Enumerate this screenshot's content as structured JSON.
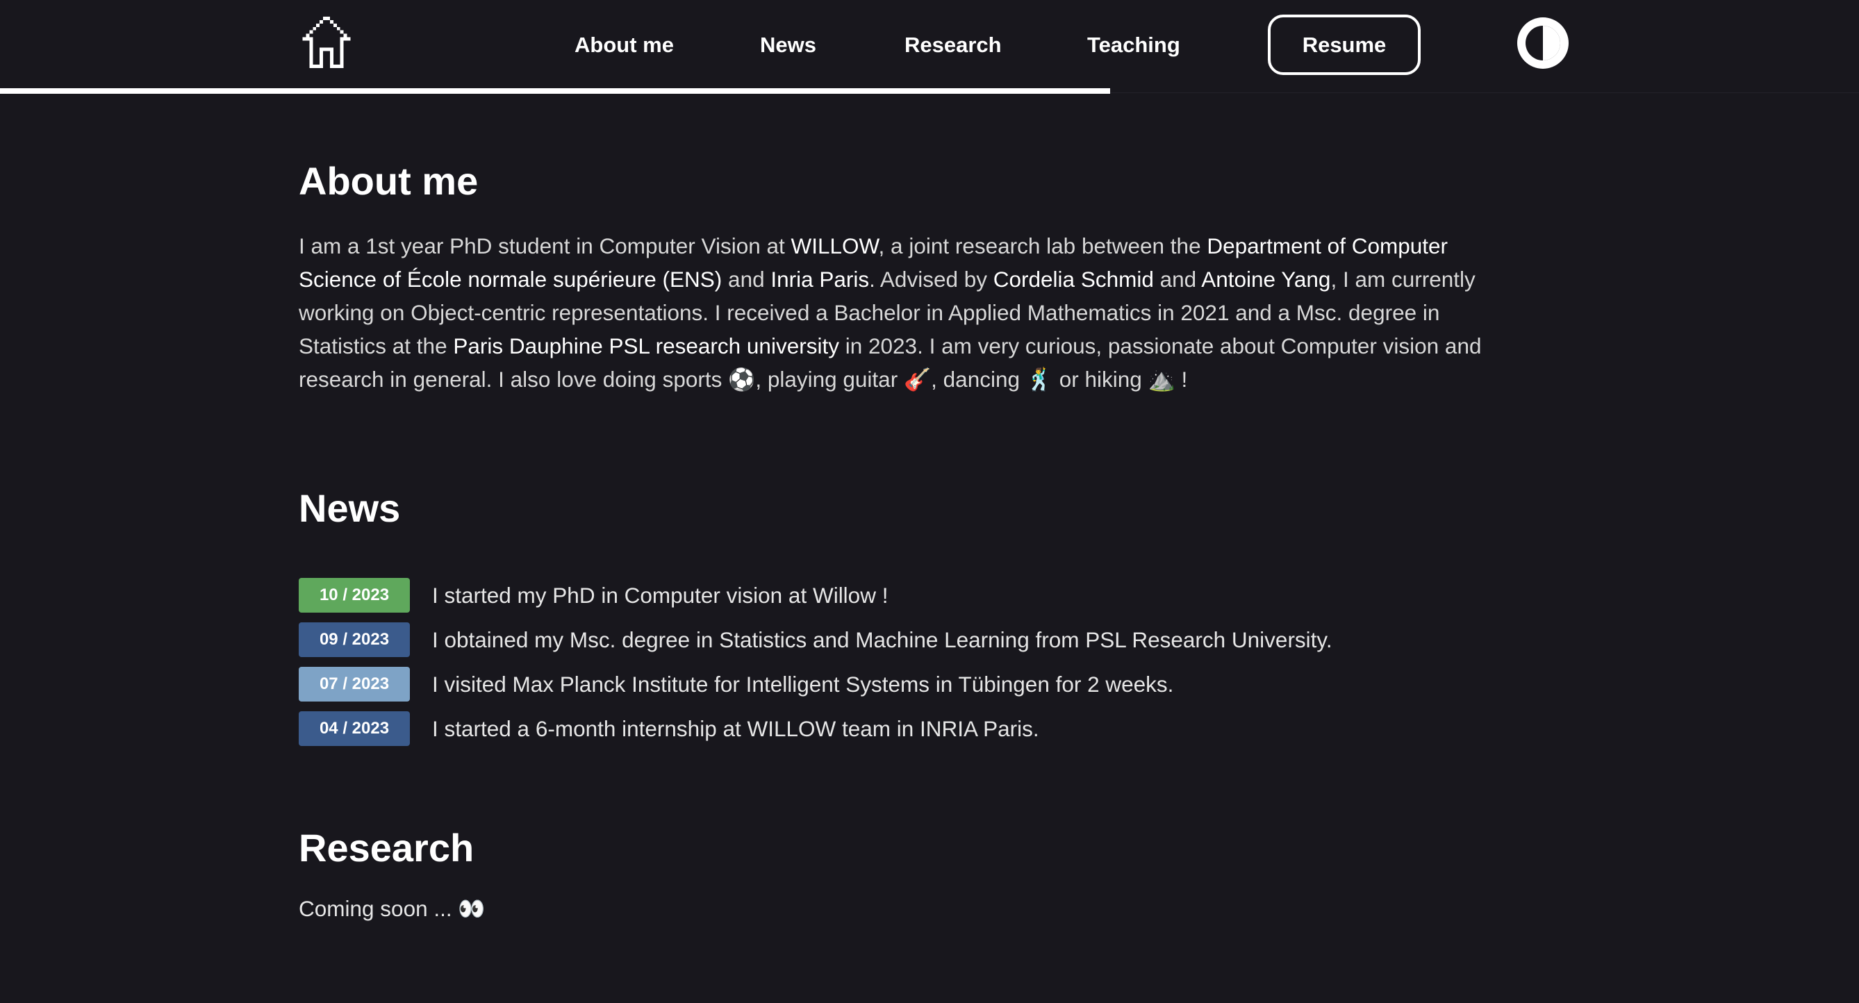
{
  "nav": {
    "home_icon": "home-icon",
    "links": [
      "About me",
      "News",
      "Research",
      "Teaching"
    ],
    "resume_label": "Resume",
    "theme_icon": "theme-toggle-icon",
    "scroll_progress": 0.597
  },
  "about": {
    "heading": "About me",
    "t1": "I am a 1st year PhD student in Computer Vision at ",
    "willow": "WILLOW",
    "t2": ", a joint research lab between the ",
    "ens": "Department of Computer Science of École normale supérieure (ENS)",
    "t3": " and ",
    "inria": "Inria Paris",
    "t4": ". Advised by ",
    "schmid": "Cordelia Schmid",
    "t5": " and ",
    "yang": "Antoine Yang",
    "t6": ", I am currently working on Object-centric representations. I received a Bachelor in Applied Mathematics in 2021 and a Msc. degree in Statistics at the ",
    "dauphine": "Paris Dauphine PSL research university",
    "t7": " in 2023. I am very curious, passionate about Computer vision and research in general. I also love doing sports ⚽, playing guitar 🎸, dancing 🕺 or hiking ⛰️ !"
  },
  "news": {
    "heading": "News",
    "items": [
      {
        "date": "10 / 2023",
        "color": "#5fa85c",
        "text": "I started my PhD in Computer vision at Willow !"
      },
      {
        "date": "09 / 2023",
        "color": "#3b5b8c",
        "text": "I obtained my Msc. degree in Statistics and Machine Learning from PSL Research University."
      },
      {
        "date": "07 / 2023",
        "color": "#7ea3c6",
        "text": "I visited Max Planck Institute for Intelligent Systems in Tübingen for 2 weeks."
      },
      {
        "date": "04 / 2023",
        "color": "#3b5b8c",
        "text": "I started a 6-month internship at WILLOW team in INRIA Paris."
      }
    ]
  },
  "research": {
    "heading": "Research",
    "text": "Coming soon ... 👀"
  }
}
